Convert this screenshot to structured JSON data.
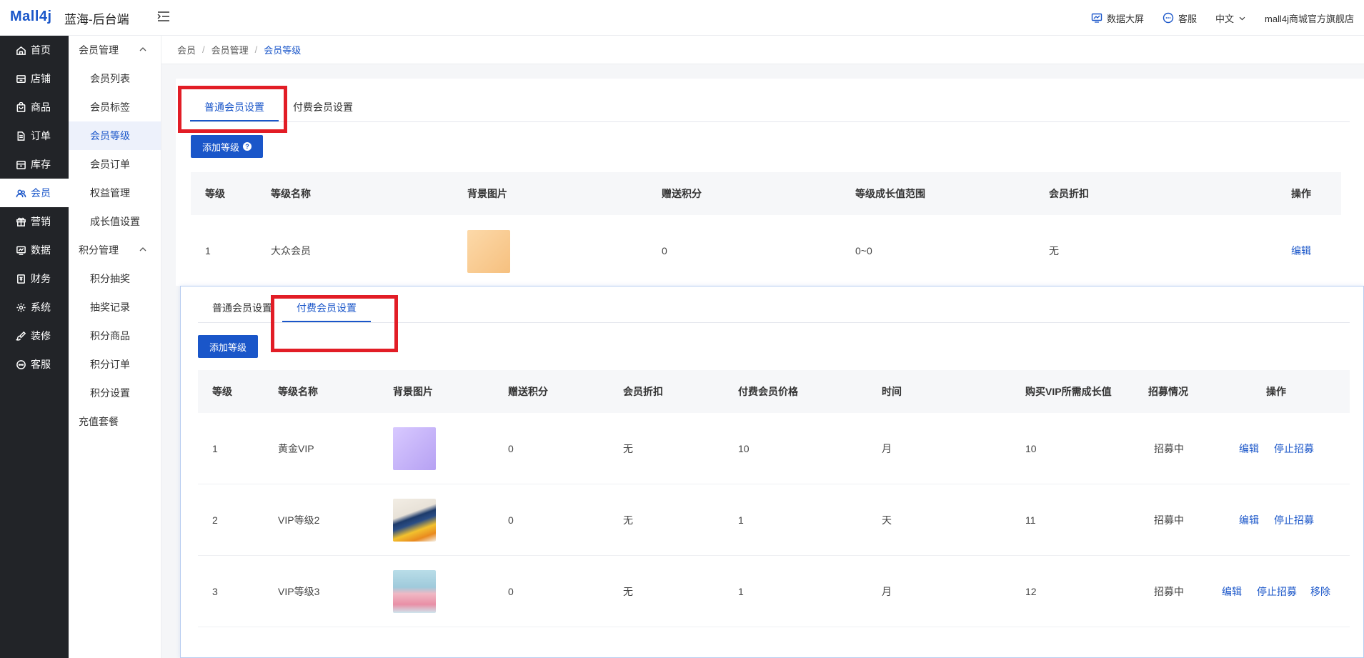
{
  "header": {
    "logo": "Mall4j",
    "title": "蓝海-后台端",
    "data_screen": "数据大屏",
    "customer_service": "客服",
    "language": "中文",
    "shop_name": "mall4j商城官方旗舰店"
  },
  "sidebar_main": [
    {
      "label": "首页",
      "icon": "home-icon"
    },
    {
      "label": "店铺",
      "icon": "shop-icon"
    },
    {
      "label": "商品",
      "icon": "bag-icon"
    },
    {
      "label": "订单",
      "icon": "order-icon"
    },
    {
      "label": "库存",
      "icon": "inventory-icon"
    },
    {
      "label": "会员",
      "icon": "user-group-icon"
    },
    {
      "label": "营销",
      "icon": "gift-icon"
    },
    {
      "label": "数据",
      "icon": "chart-icon"
    },
    {
      "label": "财务",
      "icon": "finance-icon"
    },
    {
      "label": "系统",
      "icon": "gear-icon"
    },
    {
      "label": "装修",
      "icon": "brush-icon"
    },
    {
      "label": "客服",
      "icon": "chat-icon"
    }
  ],
  "sidebar_sub": {
    "group1": "会员管理",
    "group1_items": [
      "会员列表",
      "会员标签",
      "会员等级",
      "会员订单",
      "权益管理",
      "成长值设置"
    ],
    "group2": "积分管理",
    "group2_items": [
      "积分抽奖",
      "抽奖记录",
      "积分商品",
      "积分订单",
      "积分设置"
    ],
    "group3": "充值套餐"
  },
  "breadcrumb": [
    "会员",
    "会员管理",
    "会员等级"
  ],
  "normal_panel": {
    "tab_normal": "普通会员设置",
    "tab_paid": "付费会员设置",
    "add_button": "添加等级",
    "help_icon": "?",
    "columns": [
      "等级",
      "等级名称",
      "背景图片",
      "赠送积分",
      "等级成长值范围",
      "会员折扣",
      "操作"
    ],
    "rows": [
      {
        "level": "1",
        "name": "大众会员",
        "points": "0",
        "range": "0~0",
        "discount": "无",
        "action": "编辑"
      }
    ]
  },
  "paid_panel": {
    "tab_normal": "普通会员设置",
    "tab_paid": "付费会员设置",
    "add_button": "添加等级",
    "columns": [
      "等级",
      "等级名称",
      "背景图片",
      "赠送积分",
      "会员折扣",
      "付费会员价格",
      "时间",
      "购买VIP所需成长值",
      "招募情况",
      "操作"
    ],
    "rows": [
      {
        "level": "1",
        "name": "黄金VIP",
        "points": "0",
        "discount": "无",
        "price": "10",
        "time": "月",
        "growth": "10",
        "status": "招募中",
        "edit": "编辑",
        "stop": "停止招募",
        "remove": ""
      },
      {
        "level": "2",
        "name": "VIP等级2",
        "points": "0",
        "discount": "无",
        "price": "1",
        "time": "天",
        "growth": "11",
        "status": "招募中",
        "edit": "编辑",
        "stop": "停止招募",
        "remove": ""
      },
      {
        "level": "3",
        "name": "VIP等级3",
        "points": "0",
        "discount": "无",
        "price": "1",
        "time": "月",
        "growth": "12",
        "status": "招募中",
        "edit": "编辑",
        "stop": "停止招募",
        "remove": "移除"
      }
    ]
  },
  "colors": {
    "accent": "#1a56c9",
    "highlight": "#e21d26",
    "sidebar": "#222428"
  }
}
